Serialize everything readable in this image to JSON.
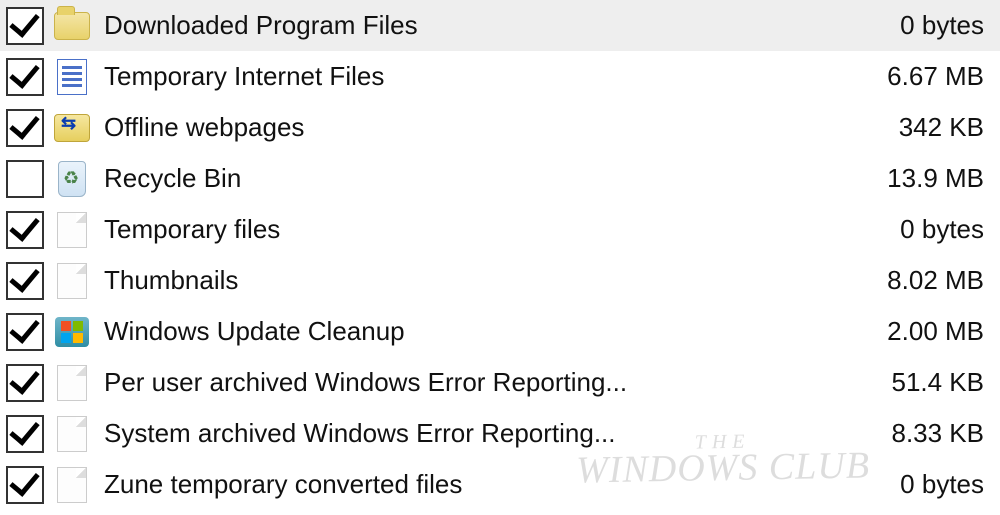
{
  "items": [
    {
      "checked": true,
      "icon": "folder-icon",
      "label": "Downloaded Program Files",
      "size": "0 bytes",
      "selected": true
    },
    {
      "checked": true,
      "icon": "document-icon",
      "label": "Temporary Internet Files",
      "size": "6.67 MB",
      "selected": false
    },
    {
      "checked": true,
      "icon": "offline-pages-icon",
      "label": "Offline webpages",
      "size": "342 KB",
      "selected": false
    },
    {
      "checked": false,
      "icon": "recycle-bin-icon",
      "label": "Recycle Bin",
      "size": "13.9 MB",
      "selected": false
    },
    {
      "checked": true,
      "icon": "blank-file-icon",
      "label": "Temporary files",
      "size": "0 bytes",
      "selected": false
    },
    {
      "checked": true,
      "icon": "blank-file-icon",
      "label": "Thumbnails",
      "size": "8.02 MB",
      "selected": false
    },
    {
      "checked": true,
      "icon": "win-update-icon",
      "label": "Windows Update Cleanup",
      "size": "2.00 MB",
      "selected": false
    },
    {
      "checked": true,
      "icon": "blank-file-icon",
      "label": "Per user archived Windows Error Reporting...",
      "size": "51.4 KB",
      "selected": false
    },
    {
      "checked": true,
      "icon": "blank-file-icon",
      "label": "System archived Windows Error Reporting...",
      "size": "8.33 KB",
      "selected": false
    },
    {
      "checked": true,
      "icon": "blank-file-icon",
      "label": "Zune temporary converted files",
      "size": "0 bytes",
      "selected": false
    }
  ],
  "watermark": {
    "line1": "THE",
    "line2": "WINDOWS CLUB"
  },
  "iconClassMap": {
    "folder-icon": "icon-folder",
    "document-icon": "icon-doc",
    "offline-pages-icon": "icon-offline",
    "recycle-bin-icon": "icon-recycle",
    "blank-file-icon": "icon-blankfile",
    "win-update-icon": "icon-winupdate"
  }
}
